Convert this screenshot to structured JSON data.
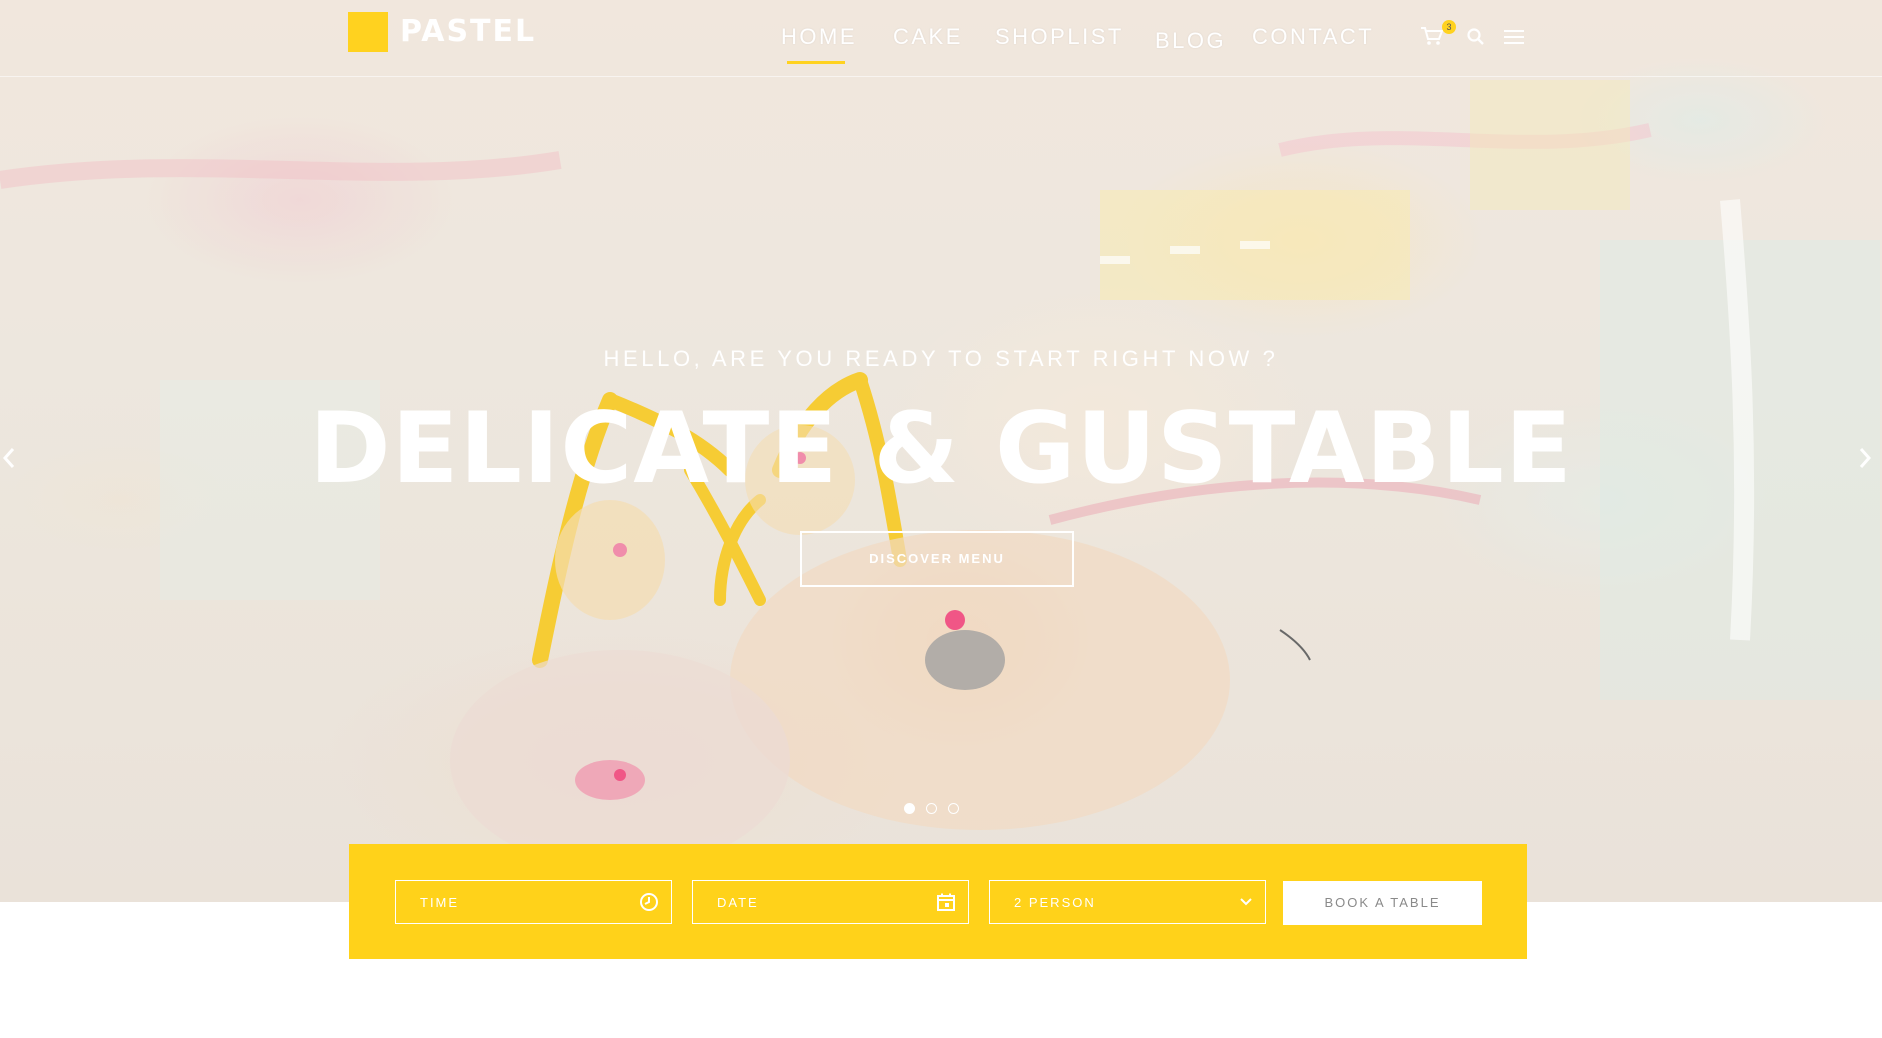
{
  "brand": {
    "name": "PASTEL",
    "accent_color": "#ffd21f"
  },
  "nav": {
    "items": [
      {
        "label": "HOME",
        "active": true
      },
      {
        "label": "CAKE"
      },
      {
        "label": "SHOPLIST"
      },
      {
        "label": "BLOG"
      },
      {
        "label": "CONTACT"
      }
    ],
    "cart_count": "3",
    "icons": [
      "cart-icon",
      "search-icon",
      "menu-icon"
    ]
  },
  "hero": {
    "tagline": "HELLO, ARE YOU READY TO START RIGHT NOW ?",
    "headline": "DELICATE & GUSTABLE",
    "cta_label": "DISCOVER MENU",
    "slides": 3,
    "active_slide": 1
  },
  "booking": {
    "time_placeholder": "TIME",
    "date_placeholder": "DATE",
    "person_selected": "2 PERSON",
    "button_label": "BOOK A TABLE"
  }
}
